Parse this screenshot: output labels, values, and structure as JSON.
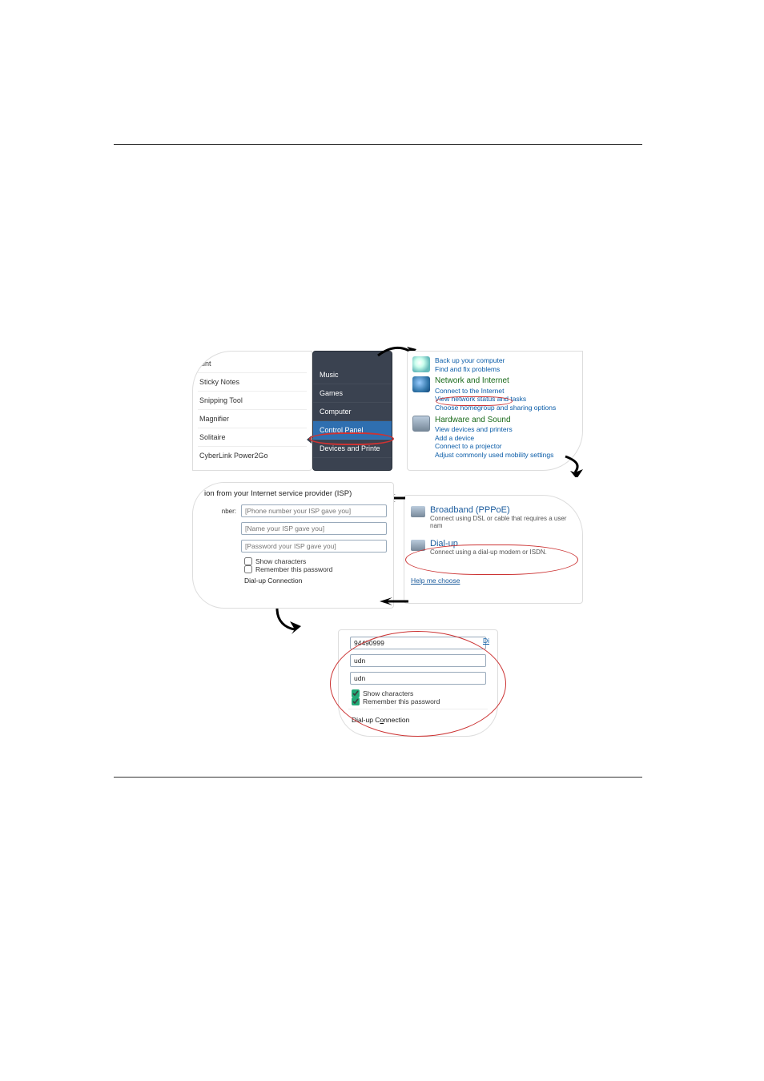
{
  "start_menu": {
    "left_items": [
      "aint",
      "Sticky Notes",
      "Snipping Tool",
      "Magnifier",
      "Solitaire",
      "CyberLink Power2Go"
    ],
    "right_items": [
      "Music",
      "Games",
      "Computer",
      "Control Panel",
      "Devices and Printe"
    ]
  },
  "control_panel": {
    "system": {
      "links": [
        "Back up your computer",
        "Find and fix problems"
      ]
    },
    "network": {
      "heading": "Network and Internet",
      "links": [
        "Connect to the Internet",
        "View network status and tasks",
        "Choose homegroup and sharing options"
      ]
    },
    "hardware": {
      "heading": "Hardware and Sound",
      "links": [
        "View devices and printers",
        "Add a device",
        "Connect to a projector",
        "Adjust commonly used mobility settings"
      ]
    }
  },
  "conn_choice": {
    "broadband": {
      "title": "Broadband (PPPoE)",
      "sub": "Connect using DSL or cable that requires a user nam"
    },
    "dialup": {
      "title": "Dial-up",
      "sub": "Connect using a dial-up modem or ISDN."
    },
    "help": "Help me choose"
  },
  "form_empty": {
    "header": "ion from your Internet service provider (ISP)",
    "nber_label": "nber:",
    "phone_placeholder": "[Phone number your ISP gave you]",
    "name_placeholder": "[Name your ISP gave you]",
    "pass_placeholder": "[Password your ISP gave you]",
    "show_chars": "Show characters",
    "remember": "Remember this password",
    "conn_name": "Dial-up Connection"
  },
  "form_filled": {
    "phone": "94490999",
    "name": "udn",
    "pass": "udn",
    "show_chars": "Show characters",
    "remember": "Remember this password",
    "conn_name_pre": "Dial-up C",
    "conn_name_u": "o",
    "conn_name_post": "nnection",
    "d_link": "Di"
  }
}
